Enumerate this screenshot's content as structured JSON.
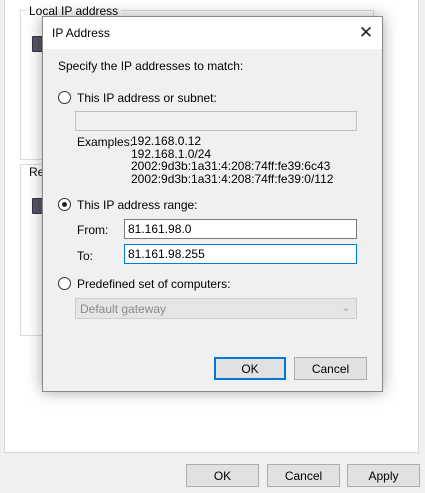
{
  "background": {
    "group_local_label": "Local IP address",
    "group_remote_label": "Re",
    "buttons": {
      "ok": "OK",
      "cancel": "Cancel",
      "apply": "Apply"
    }
  },
  "dialog": {
    "title": "IP Address",
    "close_glyph": "✕",
    "instruction": "Specify the IP addresses to match:",
    "option_subnet": {
      "label": "This IP address or subnet:",
      "selected": false,
      "value": ""
    },
    "examples_label": "Examples:",
    "examples": [
      "192.168.0.12",
      "192.168.1.0/24",
      "2002:9d3b:1a31:4:208:74ff:fe39:6c43",
      "2002:9d3b:1a31:4:208:74ff:fe39:0/112"
    ],
    "option_range": {
      "label": "This IP address range:",
      "selected": true,
      "from_label": "From:",
      "from_value": "81.161.98.0",
      "to_label": "To:",
      "to_value": "81.161.98.255"
    },
    "option_predefined": {
      "label": "Predefined set of computers:",
      "selected": false,
      "combo_value": "Default gateway"
    },
    "ok_label": "OK",
    "cancel_label": "Cancel"
  },
  "colors": {
    "accent": "#0078d7",
    "dialog_bg": "#f0f0f0",
    "button_bg": "#e1e1e1"
  }
}
